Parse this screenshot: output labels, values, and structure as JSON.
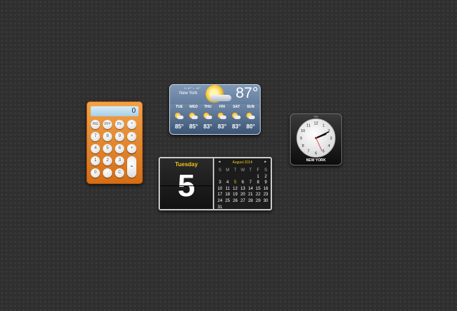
{
  "calculator": {
    "display": "0",
    "keys": [
      [
        "mc",
        "m+",
        "m-",
        "÷"
      ],
      [
        "7",
        "8",
        "9",
        "×"
      ],
      [
        "4",
        "5",
        "6",
        "-"
      ],
      [
        "1",
        "2",
        "3",
        "+"
      ],
      [
        "0",
        ".",
        "C",
        "="
      ]
    ]
  },
  "weather": {
    "hilo": "H: 87° L: 82°",
    "city": "New York",
    "temp": "87°",
    "days": [
      "TUE",
      "WED",
      "THU",
      "FRI",
      "SAT",
      "SUN"
    ],
    "highs": [
      "85°",
      "85°",
      "83°",
      "83°",
      "83°",
      "80°"
    ]
  },
  "clock": {
    "ampm": "PM",
    "city": "NEW YORK",
    "numbers": [
      "12",
      "1",
      "2",
      "3",
      "4",
      "5",
      "6",
      "7",
      "8",
      "9",
      "10",
      "11"
    ]
  },
  "calendar": {
    "weekday": "Tuesday",
    "day": "5",
    "month": "August 2014",
    "prev": "◂",
    "next": "▸",
    "dow": [
      "S",
      "M",
      "T",
      "W",
      "T",
      "F",
      "S"
    ],
    "weeks": [
      [
        "",
        "",
        "",
        "",
        "",
        "1",
        "2"
      ],
      [
        "3",
        "4",
        "5",
        "6",
        "7",
        "8",
        "9"
      ],
      [
        "10",
        "11",
        "12",
        "13",
        "14",
        "15",
        "16"
      ],
      [
        "17",
        "18",
        "19",
        "20",
        "21",
        "22",
        "23"
      ],
      [
        "24",
        "25",
        "26",
        "27",
        "28",
        "29",
        "30"
      ],
      [
        "31",
        "",
        "",
        "",
        "",
        "",
        ""
      ]
    ],
    "today": "5"
  }
}
